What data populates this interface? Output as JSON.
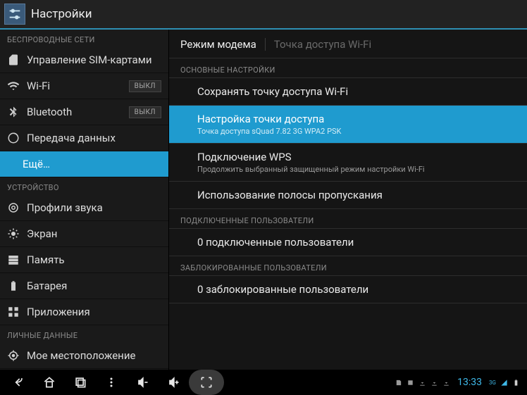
{
  "app": {
    "title": "Настройки"
  },
  "sidebar": {
    "section_wireless": "БЕСПРОВОДНЫЕ СЕТИ",
    "sim": "Управление SIM-картами",
    "wifi": "Wi-Fi",
    "wifi_toggle": "ВЫКЛ",
    "bluetooth": "Bluetooth",
    "bluetooth_toggle": "ВЫКЛ",
    "data": "Передача данных",
    "more": "Ещё…",
    "section_device": "УСТРОЙСТВО",
    "audio": "Профили звука",
    "display": "Экран",
    "storage": "Память",
    "battery": "Батарея",
    "apps": "Приложения",
    "section_personal": "ЛИЧНЫЕ ДАННЫЕ",
    "location": "Мое местоположение"
  },
  "content": {
    "breadcrumb1": "Режим модема",
    "breadcrumb2": "Точка доступа Wi-Fi",
    "section_main": "ОСНОВНЫЕ НАСТРОЙКИ",
    "item_keep": "Сохранять точку доступа Wi-Fi",
    "item_setup_title": "Настройка точки доступа",
    "item_setup_sub": "Точка доступа sQuad 7.82 3G WPA2 PSK",
    "item_wps_title": "Подключение WPS",
    "item_wps_sub": "Продолжить выбранный защищенный режим настройки Wi-Fi",
    "item_bandwidth": "Использование полосы пропускания",
    "section_connected": "ПОДКЛЮЧЕННЫЕ ПОЛЬЗОВАТЕЛИ",
    "item_connected": "0 подключенные пользователи",
    "section_blocked": "ЗАБЛОКИРОВАННЫЕ ПОЛЬЗОВАТЕЛИ",
    "item_blocked": "0 заблокированные пользователи"
  },
  "statusbar": {
    "time": "13:33",
    "data_indicator": "3G"
  }
}
